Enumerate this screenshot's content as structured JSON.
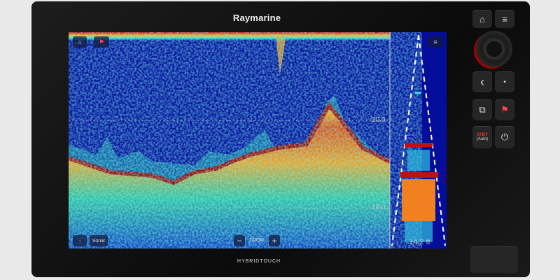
{
  "device": {
    "brand": "Raymarine",
    "model_label": "HYBRIDTOUCH"
  },
  "sonar": {
    "mode_label": "Sonar",
    "zoom_label": "ZOOM",
    "zoom_out": "−",
    "zoom_in": "+",
    "depth_scale": [
      "0.0",
      "20.0",
      "40.0"
    ],
    "current_depth": "14.2 ft",
    "colors": {
      "water": "#050e9a",
      "bottom": "#c01010",
      "strong": "#f0a020"
    }
  },
  "keypad": {
    "home": "⌂",
    "menu": "≡",
    "back": "‹",
    "ok": "•",
    "switch": "⧉",
    "waypoint": "⚑",
    "stop_label": "STBY",
    "auto_label": "(Auto)",
    "power": "⏻"
  }
}
